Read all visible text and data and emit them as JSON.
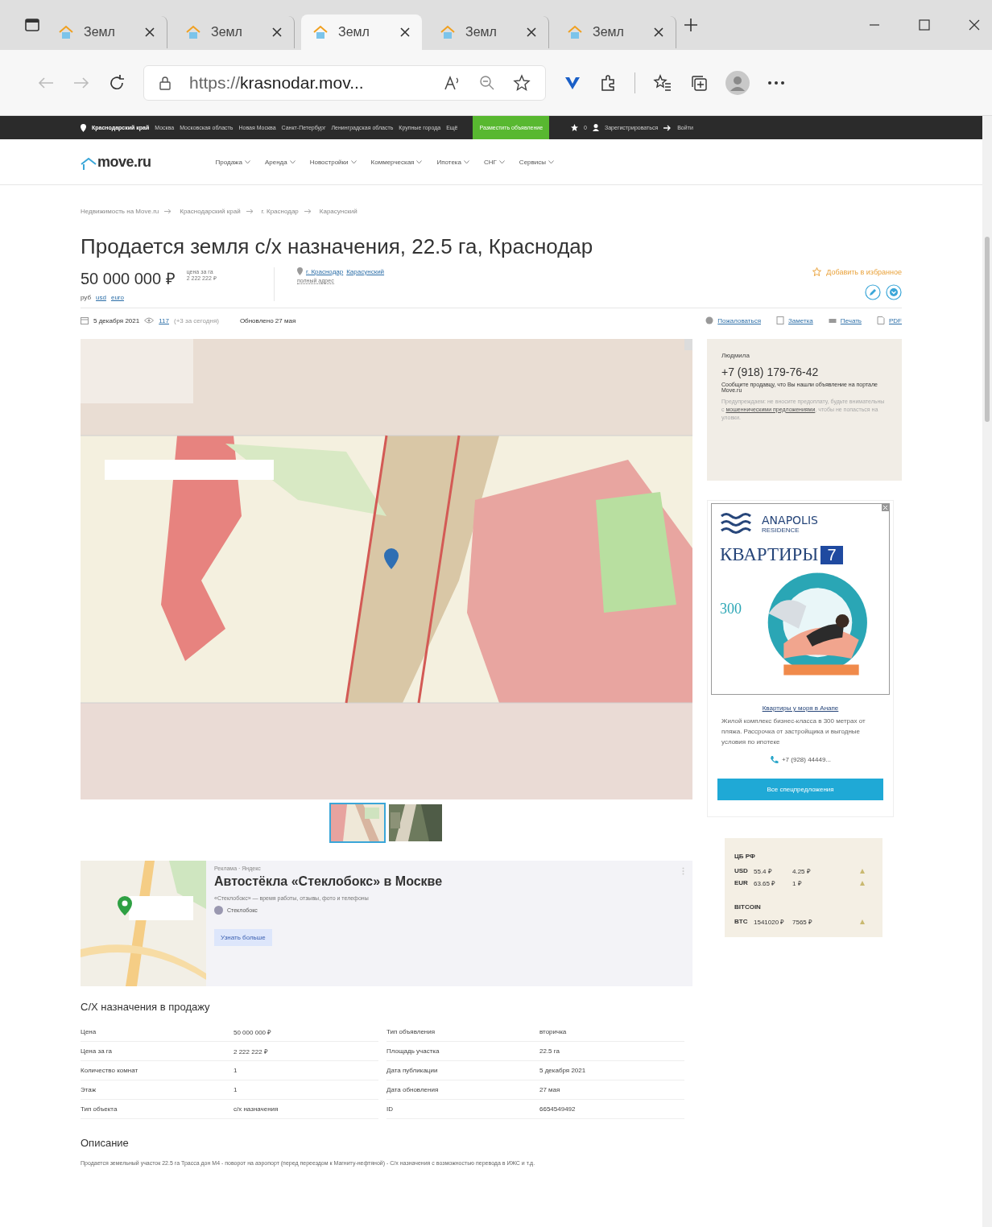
{
  "browser": {
    "tabs": [
      {
        "title": "Земл",
        "selected": false
      },
      {
        "title": "Земл",
        "selected": false
      },
      {
        "title": "Земл",
        "selected": true
      },
      {
        "title": "Земл",
        "selected": false
      },
      {
        "title": "Земл",
        "selected": false
      }
    ],
    "url": "https://**krasnodar.mov...**"
  },
  "top_strip": {
    "region": "Краснодарский край",
    "links": [
      "Москва",
      "Московская область",
      "Новая Москва",
      "Санкт-Петербург",
      "Ленинградская область",
      "Крупные города",
      "Ещё"
    ],
    "post_button": "Разместить объявление",
    "favorites_count": "0",
    "register": "Зарегистрироваться",
    "login": "Войти"
  },
  "header": {
    "logo": "move.ru",
    "nav": [
      "Продажа",
      "Аренда",
      "Новостройки",
      "Коммерческая",
      "Ипотека",
      "СНГ",
      "Сервисы"
    ]
  },
  "breadcrumbs": [
    "Недвижимость на Move.ru",
    "Краснодарский край",
    "г. Краснодар",
    "Карасунский"
  ],
  "title": "Продается земля с/х назначения, 22.5 га, Краснодар",
  "price": {
    "value": "50 000 000 ₽",
    "per_unit_label": "цена за га",
    "per_unit": "2 222 222 ₽",
    "currency_label": "руб",
    "currencies": [
      "usd",
      "euro"
    ]
  },
  "address": {
    "city": "г. Краснодар",
    "district": "Карасунский",
    "full": "полный адрес"
  },
  "favorite": "Добавить в избранное",
  "meta": {
    "date": "5 декабря 2021",
    "views": "117",
    "views_today": "(+3 за сегодня)",
    "updated": "Обновлено 27 мая",
    "actions": [
      "Пожаловаться",
      "Заметка",
      "Печать",
      "PDF"
    ]
  },
  "gallery": {
    "thumbnails": [
      {
        "selected": true
      },
      {
        "selected": false
      }
    ]
  },
  "contact": {
    "name": "Людмила",
    "phone": "+7 (918) 179-76-42",
    "note": "Сообщите продавцу, что Вы нашли объявление на портале Move.ru",
    "warning_before": "Предупреждаем: не вносите предоплату, будьте внимательны с",
    "warning_link": "мошенническими предложениями",
    "warning_after": ", чтобы не попасться на уловки."
  },
  "ad": {
    "brand": "ANAPOLIS",
    "brand_sub": "RESIDENCE",
    "headline": "КВАРТИРЫ",
    "badge": "7",
    "number": "300",
    "link": "Квартиры у моря в Анапе",
    "text": "Жилой комплекс бизнес-класса в 300 метрах от пляжа. Рассрочка от застройщика и выгодные условия по ипотеке",
    "phone": "+7 (928) 44449...",
    "button": "Все спецпредложения"
  },
  "rates": {
    "groups": [
      {
        "title": "ЦБ РФ",
        "rows": [
          {
            "code": "USD",
            "value": "55.4 ₽",
            "change": "4.25 ₽"
          },
          {
            "code": "EUR",
            "value": "63.65 ₽",
            "change": "1 ₽"
          }
        ]
      },
      {
        "title": "BITCOIN",
        "rows": [
          {
            "code": "BTC",
            "value": "1541020 ₽",
            "change": "7565 ₽"
          }
        ]
      }
    ]
  },
  "promo": {
    "label": "Реклама · Яндекс",
    "title": "Автостёкла «Стеклобокс» в Москве",
    "text": "«Стеклобокс» — время работы, отзывы, фото и телефоны",
    "source": "Стеклобокс",
    "button": "Узнать больше"
  },
  "details": {
    "title": "С/Х назначения в продажу",
    "left": [
      {
        "label": "Цена",
        "value": "50 000 000 ₽"
      },
      {
        "label": "Цена за га",
        "value": "2 222 222 ₽"
      },
      {
        "label": "Количество комнат",
        "value": "1"
      },
      {
        "label": "Этаж",
        "value": "1"
      },
      {
        "label": "Тип объекта",
        "value": "с/х назначения"
      }
    ],
    "right": [
      {
        "label": "Тип объявления",
        "value": "вторичка"
      },
      {
        "label": "Площадь участка",
        "value": "22.5 га"
      },
      {
        "label": "Дата публикации",
        "value": "5 декабря 2021"
      },
      {
        "label": "Дата обновления",
        "value": "27 мая"
      },
      {
        "label": "ID",
        "value": "6654549492"
      }
    ]
  },
  "description": {
    "title": "Описание",
    "text": "Продается земельный участок 22.5 га Трасса дон М4 - поворот на аэропорт (перед переездом к Магниту-нефтяной) - С/х назначения с возможностью перевода в ИЖС и т.д."
  }
}
